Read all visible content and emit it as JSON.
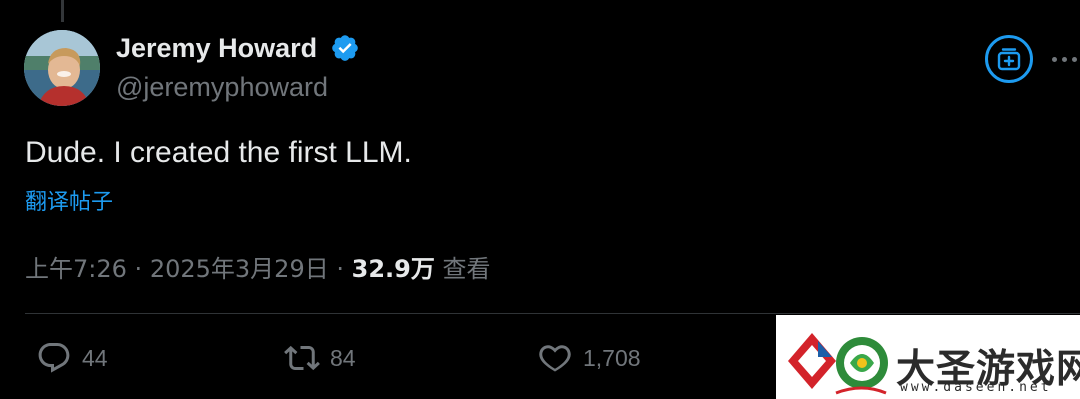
{
  "author": {
    "display_name": "Jeremy Howard",
    "handle": "@jeremyphoward",
    "verified": true
  },
  "tweet": {
    "text": "Dude. I created the first LLM.",
    "translate_label": "翻译帖子"
  },
  "meta": {
    "time": "上午7:26",
    "separator": "·",
    "date": "2025年3月29日",
    "views_count": "32.9万",
    "views_label": "查看"
  },
  "actions": {
    "replies": "44",
    "reposts": "84",
    "likes": "1,708"
  },
  "watermark": {
    "title": "大圣游戏网",
    "url": "www.daseen.net"
  },
  "colors": {
    "background": "#000000",
    "primary_text": "#e7e9ea",
    "secondary_text": "#71767b",
    "accent": "#1d9bf0",
    "divider": "#2f3336"
  },
  "icons": {
    "verified": "verified-badge-icon",
    "grok": "grok-icon",
    "more": "more-icon",
    "reply": "reply-icon",
    "repost": "repost-icon",
    "like": "heart-icon"
  }
}
